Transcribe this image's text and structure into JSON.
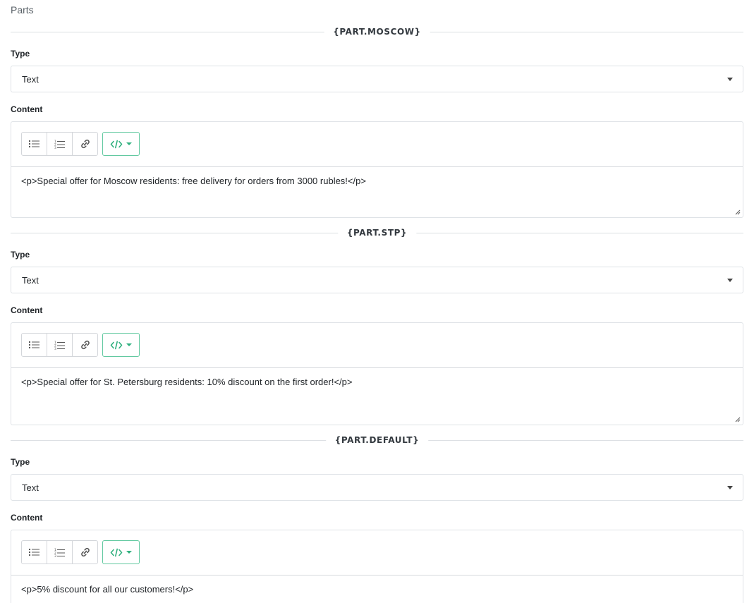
{
  "section_title": "Parts",
  "type_label": "Type",
  "content_label": "Content",
  "toolbar": {
    "bullet_list_icon": "bullet-list-icon",
    "numbered_list_icon": "numbered-list-icon",
    "link_icon": "link-icon",
    "code_icon": "code-icon"
  },
  "accent_color": "#2fb07e",
  "parts": [
    {
      "title": "{PART.MOSCOW}",
      "type": "Text",
      "content": "<p>Special offer for Moscow residents: free delivery for orders from 3000 rubles!</p>"
    },
    {
      "title": "{PART.STP}",
      "type": "Text",
      "content": "<p>Special offer for St. Petersburg residents: 10% discount on the first order!</p>"
    },
    {
      "title": "{PART.DEFAULT}",
      "type": "Text",
      "content": "<p>5% discount for all our customers!</p>"
    }
  ]
}
